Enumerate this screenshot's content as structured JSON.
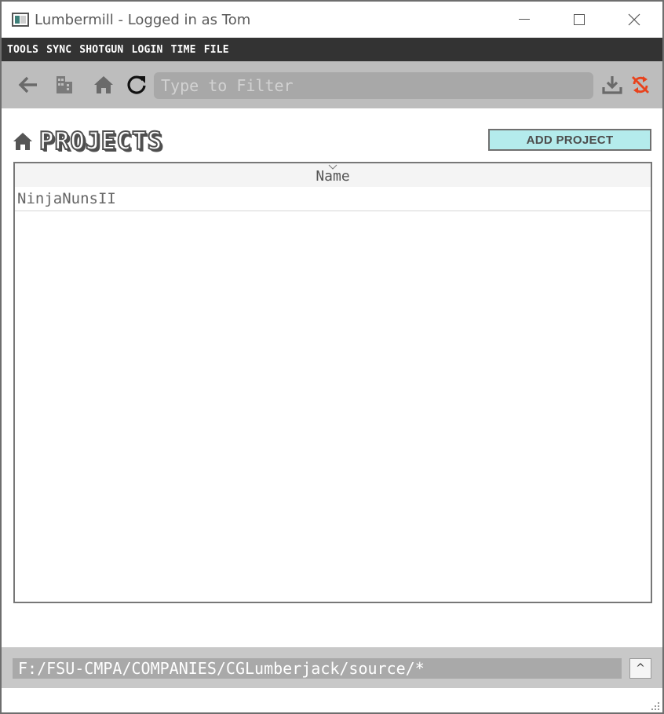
{
  "window": {
    "title": "Lumbermill - Logged in as Tom",
    "controls": {
      "minimize": "minimize",
      "maximize": "maximize",
      "close": "close"
    }
  },
  "menu": {
    "items": [
      "TOOLS",
      "SYNC",
      "SHOTGUN",
      "LOGIN",
      "TIME",
      "FILE"
    ]
  },
  "toolbar": {
    "back_icon": "arrow-left-icon",
    "company_icon": "building-icon",
    "home_icon": "home-icon",
    "refresh_icon": "refresh-icon",
    "filter_placeholder": "Type to Filter",
    "filter_value": "",
    "download_icon": "download-icon",
    "sync_off_icon": "sync-disabled-icon",
    "sync_off_color": "#e8431d"
  },
  "projects": {
    "title": "PROJECTS",
    "add_button": "ADD PROJECT",
    "add_button_color": "#b4ebec",
    "table": {
      "columns": [
        "Name"
      ],
      "sort_indicator": "descending",
      "rows": [
        {
          "name": "NinjaNunsII"
        }
      ]
    }
  },
  "footer": {
    "path": "F:/FSU-CMPA/COMPANIES/CGLumberjack/source/*",
    "expand_button": "^"
  }
}
